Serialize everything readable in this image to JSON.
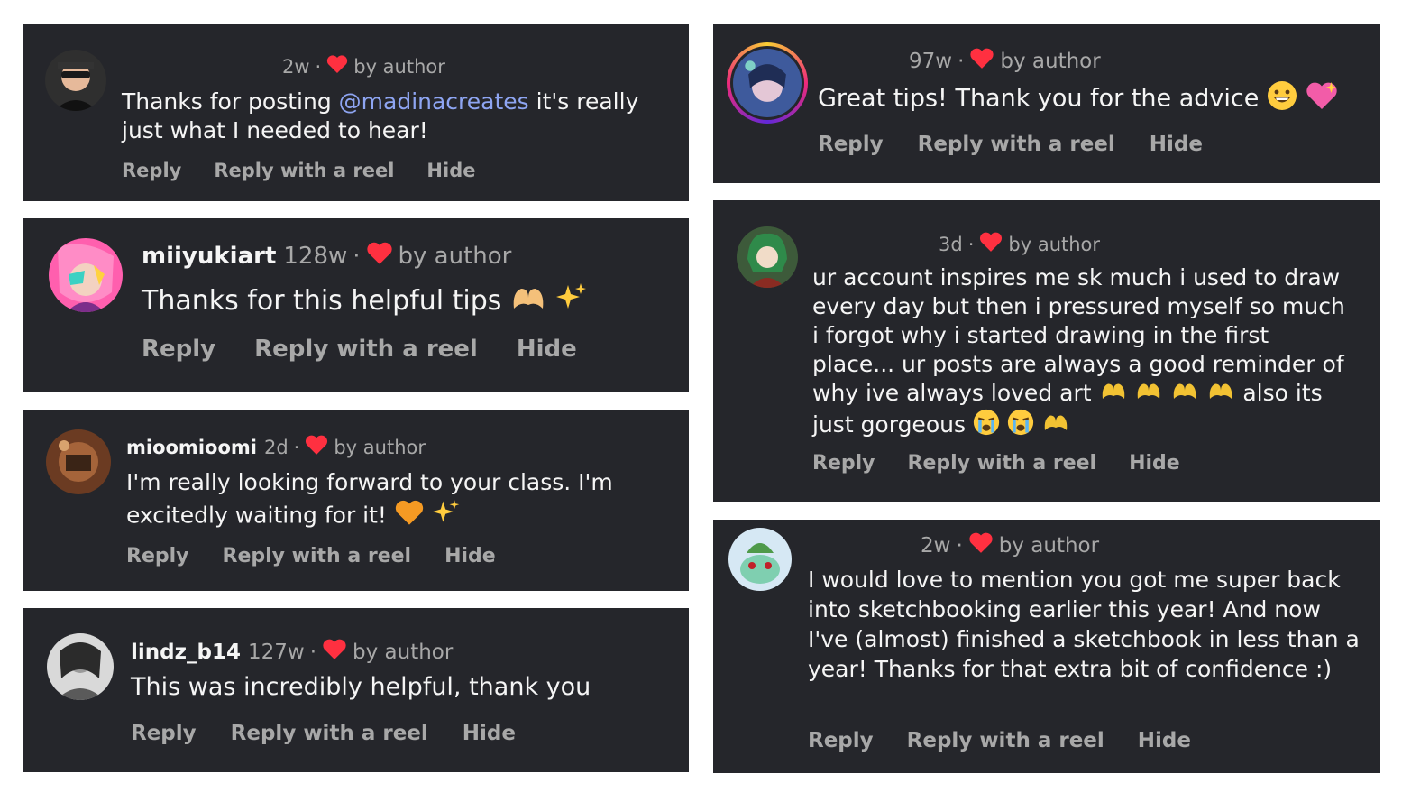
{
  "labels": {
    "reply": "Reply",
    "reply_reel": "Reply with a reel",
    "hide": "Hide",
    "by_author": "by author",
    "dot": "·"
  },
  "colors": {
    "card": "#25262b",
    "heart": "#ff3040",
    "mention": "#8ea5f2",
    "muted": "#a8a8a8"
  },
  "comments": [
    {
      "username": "",
      "time": "2w",
      "text_before": "Thanks for posting ",
      "mention": "@madinacreates",
      "text_after": " it's really just what I needed to hear!"
    },
    {
      "username": "miiyukiart",
      "time": "128w",
      "text": "Thanks for this helpful tips",
      "emojis": [
        "heart-hands-emoji",
        "sparkles-emoji"
      ]
    },
    {
      "username": "mioomioomi",
      "time": "2d",
      "text": "I'm really looking forward to your class. I'm excitedly waiting for it!",
      "emojis": [
        "orange-heart-emoji",
        "sparkles-emoji"
      ]
    },
    {
      "username": "lindz_b14",
      "time": "127w",
      "text": "This was incredibly helpful, thank you"
    },
    {
      "username": "",
      "time": "97w",
      "text": "Great tips! Thank you for the advice",
      "emojis": [
        "grinning-face-emoji",
        "sparkling-heart-emoji"
      ]
    },
    {
      "username": "",
      "time": "3d",
      "text": "ur account inspires me sk much i used to draw every day but then i pressured myself so much i forgot why i started drawing in the first place... ur posts are always a good reminder of why ive always loved art",
      "text_mid": " also its just gorgeous",
      "emojis": [
        "heart-hands-emoji",
        "heart-hands-emoji",
        "heart-hands-emoji",
        "heart-hands-emoji"
      ],
      "emojis_end": [
        "crying-face-emoji",
        "crying-face-emoji",
        "heart-hands-emoji"
      ]
    },
    {
      "username": "",
      "time": "2w",
      "text": "I would love to mention you got me super back into sketchbooking earlier this year! And now I've (almost) finished a sketchbook in less than a year! Thanks for that extra bit of confidence :)"
    }
  ]
}
